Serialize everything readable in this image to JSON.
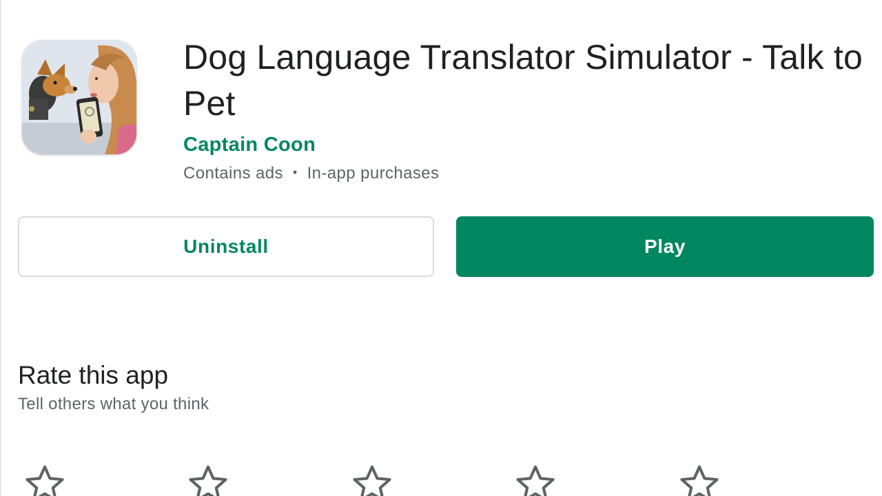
{
  "app": {
    "title": "Dog Language Translator Simulator - Talk to Pet",
    "developer": "Captain Coon",
    "meta": {
      "ads": "Contains ads",
      "separator": "•",
      "purchases": "In-app purchases"
    },
    "icon": "app-icon-dog-and-woman-with-phone"
  },
  "actions": {
    "uninstall_label": "Uninstall",
    "play_label": "Play"
  },
  "rating": {
    "title": "Rate this app",
    "subtitle": "Tell others what you think",
    "star_icon": "star-outline-icon",
    "star_count": 5
  },
  "colors": {
    "accent": "#01875f",
    "text_primary": "#202124",
    "text_secondary": "#5f6368",
    "border": "#dadce0",
    "star": "#5f6368"
  }
}
